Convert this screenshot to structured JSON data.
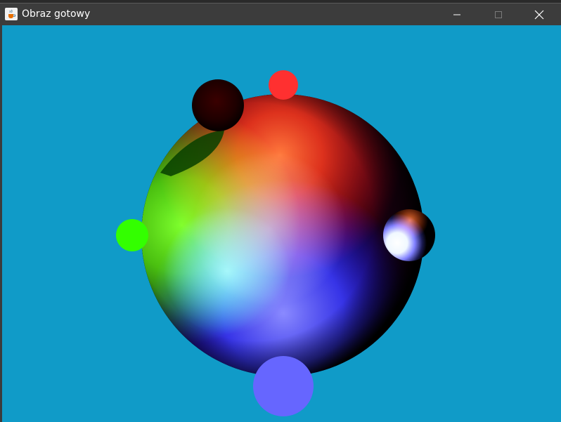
{
  "window": {
    "title": "Obraz gotowy",
    "app_icon": "java-cup-icon",
    "controls": {
      "minimize": "minimize-icon",
      "maximize": "maximize-icon",
      "close": "close-icon"
    }
  },
  "scene": {
    "background_color": "#109bc8",
    "main_sphere": "rendered-sphere",
    "light_colors": [
      "#ff3030",
      "#33ff00",
      "#6666ff"
    ],
    "small_spheres": [
      "dark-red-sphere",
      "white-glossy-sphere"
    ]
  }
}
